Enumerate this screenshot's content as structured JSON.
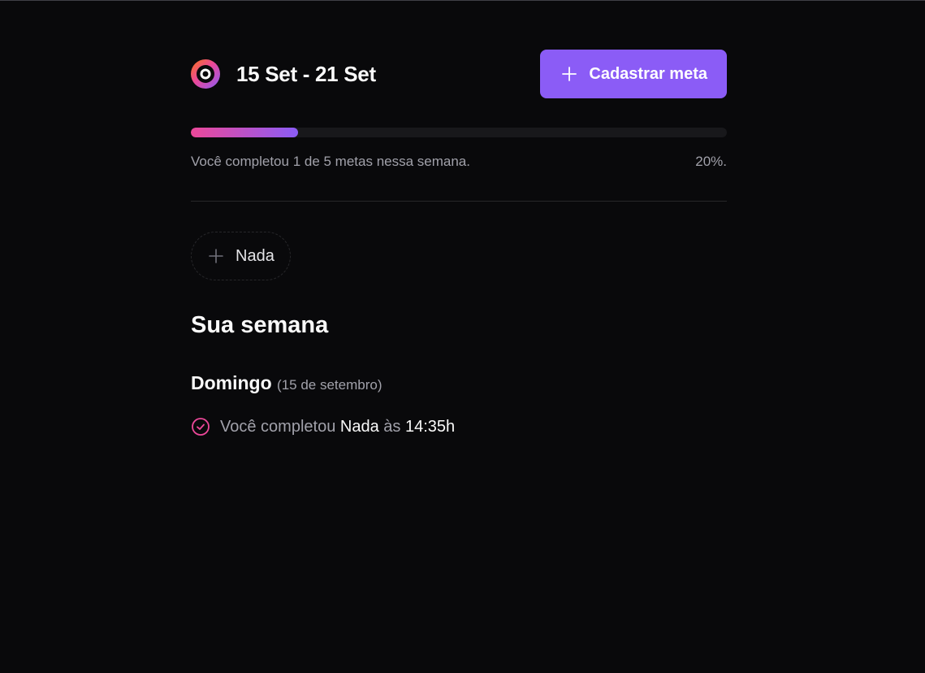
{
  "header": {
    "week_range": "15 Set - 21 Set",
    "create_goal_label": "Cadastrar meta"
  },
  "progress": {
    "completed": 1,
    "total": 5,
    "fraction": 0.2,
    "summary_text": "Você completou 1 de 5 metas nessa semana.",
    "percent_text": "20%."
  },
  "pending_goals": [
    {
      "title": "Nada"
    }
  ],
  "week_summary": {
    "title": "Sua semana",
    "days": [
      {
        "weekday": "Domingo",
        "date_label": "(15 de setembro)",
        "completions": [
          {
            "prefix": "Você completou",
            "goal": "Nada",
            "connector": "às",
            "time": "14:35h"
          }
        ]
      }
    ]
  },
  "colors": {
    "accent": "#8b5cf6",
    "accent_pink": "#ec4899",
    "background": "#09090b"
  },
  "icons": {
    "logo": "in-orbit-logo-icon",
    "add": "plus-icon",
    "completed": "circle-check-icon"
  }
}
